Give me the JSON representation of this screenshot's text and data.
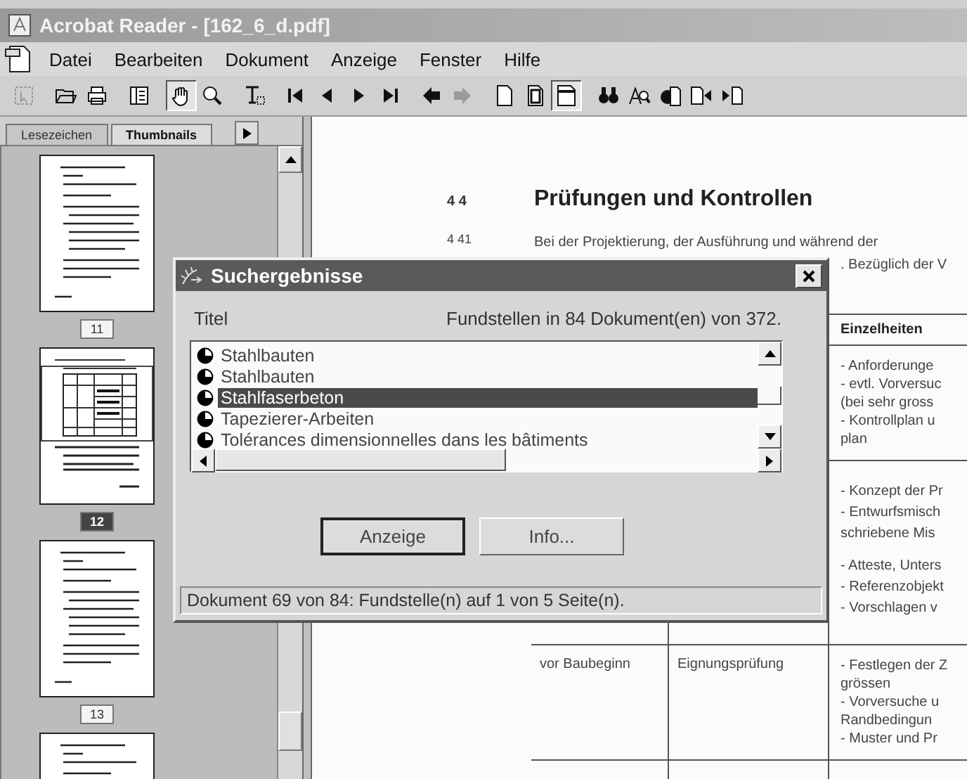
{
  "window": {
    "title": "Acrobat Reader - [162_6_d.pdf]"
  },
  "menu": [
    {
      "label": "Datei"
    },
    {
      "label": "Bearbeiten"
    },
    {
      "label": "Dokument"
    },
    {
      "label": "Anzeige"
    },
    {
      "label": "Fenster"
    },
    {
      "label": "Hilfe"
    }
  ],
  "toolbar": [
    {
      "kind": "select",
      "selected": false,
      "disabled": true
    },
    {
      "kind": "open",
      "selected": false,
      "disabled": false
    },
    {
      "kind": "print",
      "selected": false,
      "disabled": false
    },
    {
      "kind": "panel",
      "selected": false,
      "disabled": false
    },
    {
      "kind": "hand",
      "selected": true,
      "disabled": false
    },
    {
      "kind": "zoom",
      "selected": false,
      "disabled": false
    },
    {
      "kind": "text",
      "selected": false,
      "disabled": false
    },
    {
      "kind": "first",
      "selected": false,
      "disabled": false
    },
    {
      "kind": "prev",
      "selected": false,
      "disabled": false
    },
    {
      "kind": "next",
      "selected": false,
      "disabled": false
    },
    {
      "kind": "last",
      "selected": false,
      "disabled": false
    },
    {
      "kind": "back",
      "selected": false,
      "disabled": false
    },
    {
      "kind": "forward",
      "selected": false,
      "disabled": true
    },
    {
      "kind": "page",
      "selected": false,
      "disabled": false
    },
    {
      "kind": "fitpage",
      "selected": false,
      "disabled": false
    },
    {
      "kind": "fitwidth",
      "selected": true,
      "disabled": false
    },
    {
      "kind": "find",
      "selected": false,
      "disabled": false
    },
    {
      "kind": "search",
      "selected": false,
      "disabled": false
    },
    {
      "kind": "results",
      "selected": false,
      "disabled": false
    },
    {
      "kind": "prevhit",
      "selected": false,
      "disabled": false
    },
    {
      "kind": "nexthit",
      "selected": false,
      "disabled": false
    }
  ],
  "sidebar": {
    "tabs": [
      {
        "label": "Lesezeichen",
        "selected": false
      },
      {
        "label": "Thumbnails",
        "selected": true
      }
    ],
    "pages": [
      {
        "label": "11",
        "selected": false,
        "kind": "text"
      },
      {
        "label": "12",
        "selected": true,
        "kind": "table"
      },
      {
        "label": "13",
        "selected": false,
        "kind": "text"
      },
      {
        "selected": false,
        "kind": "text"
      }
    ]
  },
  "document": {
    "section_number": "4 4",
    "heading": "Prüfungen und Kontrollen",
    "paragraph_number": "4 41",
    "paragraph_lines": [
      "Bei der Projektierung, der Ausführung und während der",
      ". Bezüglich der V"
    ],
    "table": {
      "header": "Einzelheiten",
      "rows": [
        {
          "details": [
            "- Anforderunge",
            "- evtl. Vorversuc",
            "(bei sehr gross",
            "- Kontrollplan u",
            "plan"
          ]
        },
        {
          "details": [
            "- Konzept der Pr",
            "- Entwurfsmisch",
            "schriebene Mis",
            "- Atteste, Unters",
            "- Referenzobjekt",
            "- Vorschlagen v"
          ]
        },
        {
          "column_1": "vor Baubeginn",
          "column_2": "Eignungsprüfung",
          "details": [
            "- Festlegen der Z",
            "grössen",
            "- Vorversuche u",
            "Randbedingun",
            "- Muster und Pr"
          ]
        }
      ]
    }
  },
  "dialog": {
    "title": "Suchergebnisse",
    "list_label": {
      "text": "Titel"
    },
    "summary": "Fundstellen in 84 Dokument(en) von 372.",
    "results": [
      {
        "title": "Stahlbauten",
        "selected": false
      },
      {
        "title": "Stahlbauten",
        "selected": false
      },
      {
        "title": "Stahlfaserbeton",
        "selected": true
      },
      {
        "title": "Tapezierer-Arbeiten",
        "selected": false
      },
      {
        "title": "Tolérances dimensionnelles dans les bâtiments",
        "selected": false
      }
    ],
    "buttons": [
      {
        "label": "Anzeige",
        "default": true
      },
      {
        "label": "Info...",
        "default": false
      }
    ],
    "status": "Dokument 69 von 84: Fundstelle(n) auf 1 von 5 Seite(n)."
  }
}
